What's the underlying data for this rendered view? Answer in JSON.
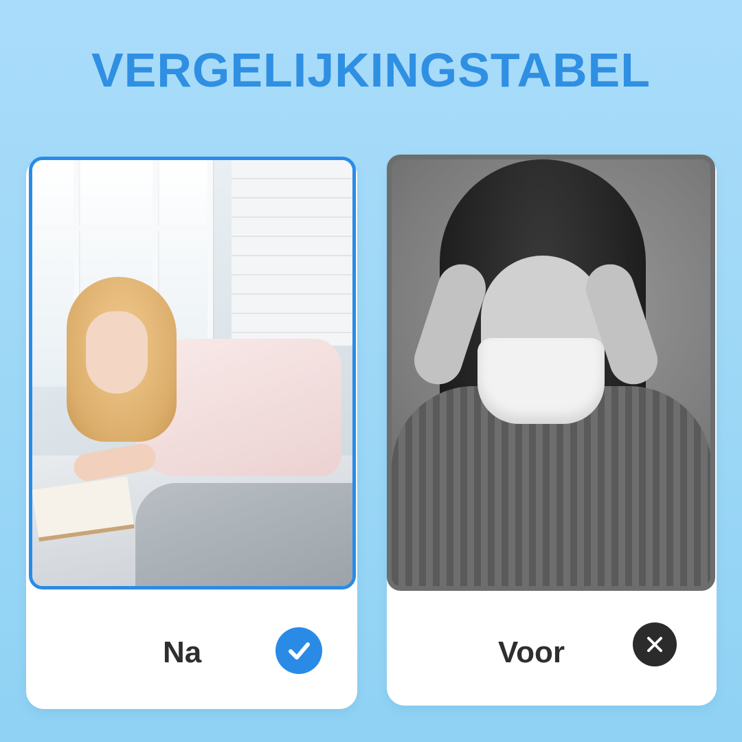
{
  "title": "VERGELIJKINGSTABEL",
  "colors": {
    "title": "#2f8fe2",
    "accent_blue": "#2a8be6",
    "background": "#9fd8f7",
    "card": "#ffffff",
    "dark": "#2b2b2b"
  },
  "cards": [
    {
      "label": "Na",
      "status_icon": "check-circle-icon",
      "photo": "smiling woman reading on bed"
    },
    {
      "label": "Voor",
      "status_icon": "x-circle-icon",
      "photo": "stressed woman with face mask"
    }
  ]
}
